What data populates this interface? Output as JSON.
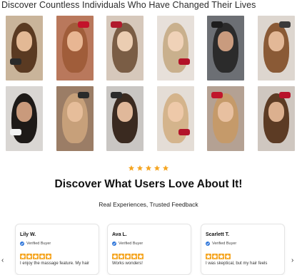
{
  "gallery": {
    "title": "Discover Countless Individuals Who Have Changed Their Lives",
    "thumbs_row1": [
      {
        "bg": "#c9b49a",
        "hair": "#5a3a22",
        "face": "#e3b995",
        "device": "#2a2a2a"
      },
      {
        "bg": "#b9785c",
        "hair": "#a05d3a",
        "face": "#e8b693",
        "device": "#c3122a"
      },
      {
        "bg": "#d6c8bb",
        "hair": "#7a5d45",
        "face": "#ebcdb2",
        "device": "#b11a2c"
      },
      {
        "bg": "#e7e0da",
        "hair": "#c9b08d",
        "face": "#f0d2b8",
        "device": "#b31228"
      },
      {
        "bg": "#6c6f74",
        "hair": "#2b2b2b",
        "face": "#c99b7e",
        "device": "#1d1d1d"
      },
      {
        "bg": "#ddd6cf",
        "hair": "#8a5a36",
        "face": "#e3b897",
        "device": "#3a3a3a"
      }
    ],
    "thumbs_row2": [
      {
        "bg": "#d9d6d3",
        "hair": "#1e1a18",
        "face": "#c99a7c",
        "device": "#f2f2f2"
      },
      {
        "bg": "#9b7d66",
        "hair": "#c7a07a",
        "face": "#e6bd9a",
        "device": "#2a2a2a"
      },
      {
        "bg": "#c9c6c3",
        "hair": "#3a2a20",
        "face": "#e0b89a",
        "device": "#2b2b2b"
      },
      {
        "bg": "#e4ddd6",
        "hair": "#d4b48c",
        "face": "#eec9a9",
        "device": "#b3142a"
      },
      {
        "bg": "#b4a193",
        "hair": "#c59a6a",
        "face": "#e8c0a0",
        "device": "#c0162c"
      },
      {
        "bg": "#cfc7c0",
        "hair": "#5c3b24",
        "face": "#dcb08f",
        "device": "#b8122a"
      }
    ]
  },
  "rating": {
    "stars": 5,
    "color": "#f5a623"
  },
  "section": {
    "heading": "Discover What Users Love About It!",
    "subheading": "Real Experiences, Trusted Feedback"
  },
  "reviews": [
    {
      "name": "Lily W.",
      "badge": "Verified Buyer",
      "stars": 5,
      "text": "I enjoy the massage feature. My hair"
    },
    {
      "name": "Ava L.",
      "badge": "Verified Buyer",
      "stars": 5,
      "text": "Works wonders!"
    },
    {
      "name": "Scarlett T.",
      "badge": "Verified Buyer",
      "stars": 4,
      "text": "I was skeptical, but my hair feels"
    }
  ],
  "nav": {
    "prev": "‹",
    "next": "›"
  }
}
